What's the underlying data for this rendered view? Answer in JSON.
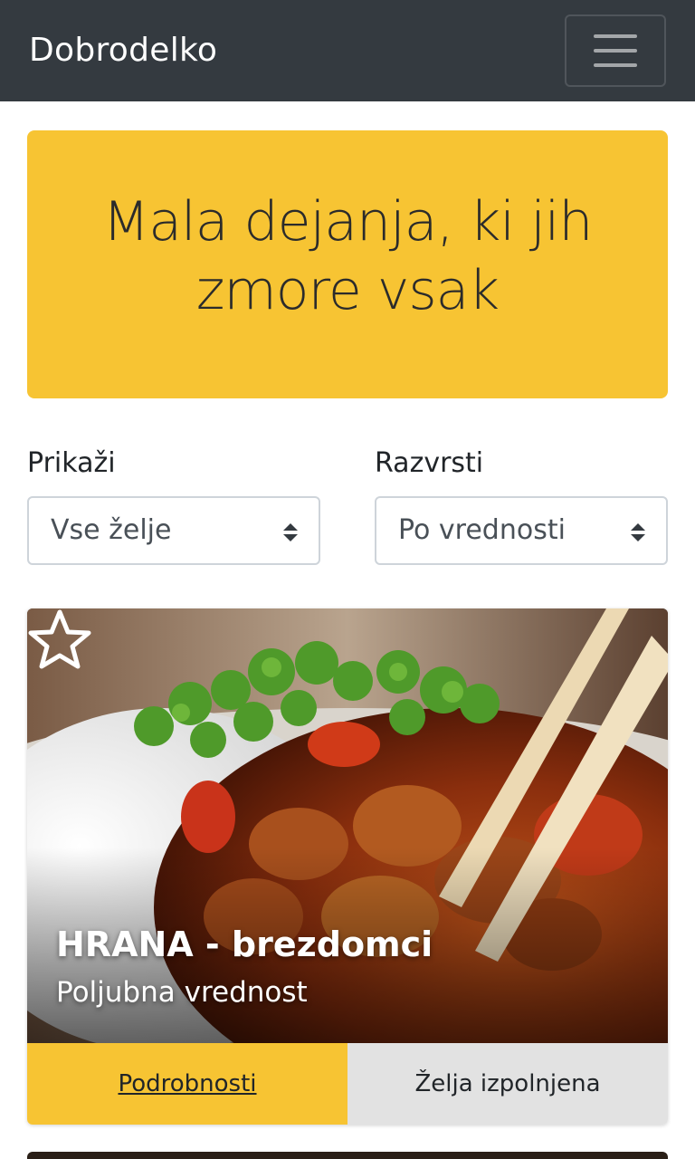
{
  "navbar": {
    "brand": "Dobrodelko",
    "menu_icon": "hamburger-menu-icon"
  },
  "jumbotron": {
    "heading": "Mala dejanja, ki jih zmore vsak"
  },
  "filters": {
    "show": {
      "label": "Prikaži",
      "selected": "Vse želje"
    },
    "sort": {
      "label": "Razvrsti",
      "selected": "Po vrednosti"
    }
  },
  "cards": [
    {
      "title": "HRANA - brezdomci",
      "subtitle": "Poljubna vrednost",
      "favorite_icon": "star-outline-icon",
      "details_label": "Podrobnosti",
      "fulfilled_label": "Želja izpolnjena"
    }
  ],
  "colors": {
    "accent": "#f7c433",
    "navbar": "#343a40",
    "fulfilled_bg": "#e2e2e2"
  }
}
